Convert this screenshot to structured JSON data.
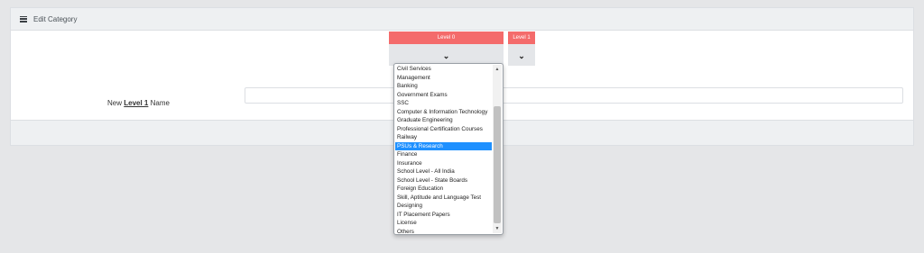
{
  "panel": {
    "title": "Edit Category"
  },
  "levels": [
    {
      "label": "Level 0"
    },
    {
      "label": "Level 1"
    }
  ],
  "form": {
    "label_prefix": "New",
    "label_level": "Level 1",
    "label_suffix": "Name",
    "name_value": ""
  },
  "dropdown": {
    "selected": "PSUs & Research",
    "options": [
      "Civil Services",
      "Management",
      "Banking",
      "Government Exams",
      "SSC",
      "Computer & Information Technology",
      "Graduate Engineering",
      "Professional Certification Courses",
      "Railway",
      "PSUs & Research",
      "Finance",
      "Insurance",
      "School Level - All India",
      "School Level - State Boards",
      "Foreign Education",
      "Skill, Aptitude and Language Test",
      "Designing",
      "IT Placement Papers",
      "License",
      "Others"
    ]
  },
  "icons": {
    "menu": "hamburger-icon",
    "chevron": "chevron-down-icon"
  },
  "colors": {
    "level_header": "#f46b6b",
    "selected_option": "#1e90ff"
  }
}
